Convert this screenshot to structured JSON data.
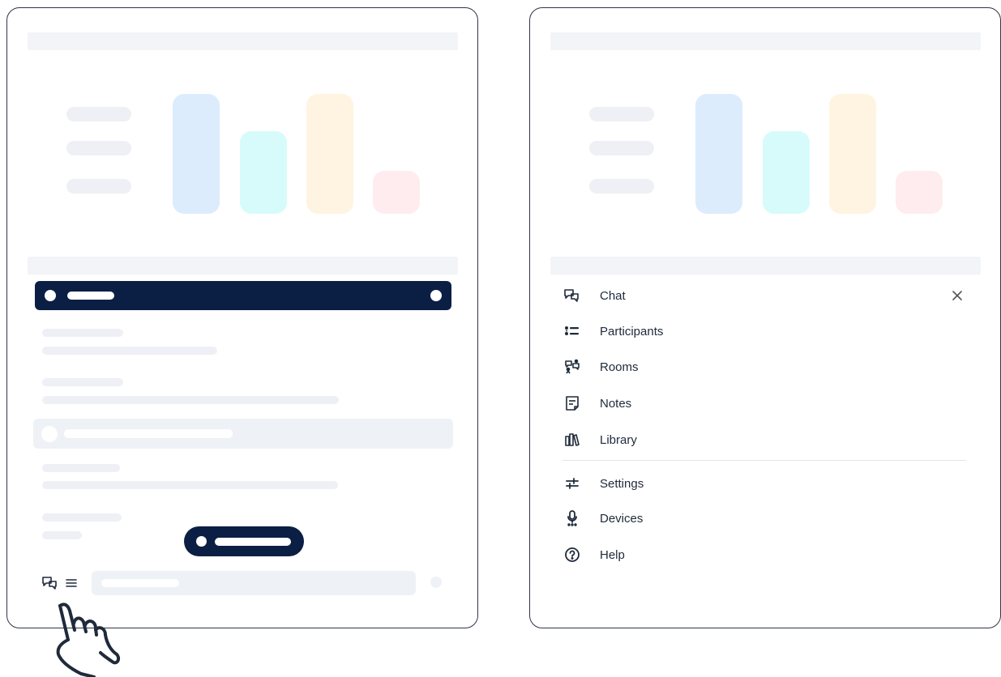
{
  "colors": {
    "navy": "#0b1f44",
    "placeholder": "#eef0f5",
    "bar_blue": "#dcecfd",
    "bar_cyan": "#d6fbfa",
    "bar_yellow": "#fef4e1",
    "bar_pink": "#feecee",
    "text": "#1f2a3a"
  },
  "menu": {
    "items": [
      {
        "label": "Chat",
        "icon": "chat-icon"
      },
      {
        "label": "Participants",
        "icon": "participants-icon"
      },
      {
        "label": "Rooms",
        "icon": "rooms-icon"
      },
      {
        "label": "Notes",
        "icon": "notes-icon"
      },
      {
        "label": "Library",
        "icon": "library-icon"
      },
      {
        "label": "Settings",
        "icon": "settings-icon"
      },
      {
        "label": "Devices",
        "icon": "devices-icon"
      },
      {
        "label": "Help",
        "icon": "help-icon"
      }
    ],
    "close_icon": "close-icon"
  }
}
